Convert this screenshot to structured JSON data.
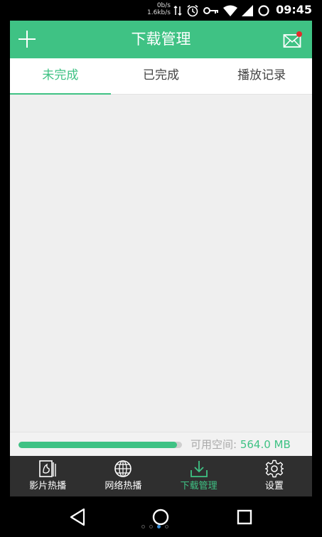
{
  "status_bar": {
    "upload_speed": "0b/s",
    "download_speed": "1.6kb/s",
    "time": "09:45",
    "icons": [
      "data-arrows-icon",
      "alarm-icon",
      "key-icon",
      "wifi-icon",
      "signal-icon",
      "sync-icon"
    ]
  },
  "header": {
    "title": "下载管理",
    "add_icon": "plus-icon",
    "mail_icon": "mail-icon",
    "mail_has_notification": true,
    "color": "#3fc284"
  },
  "tabs": [
    {
      "label": "未完成",
      "active": true
    },
    {
      "label": "已完成",
      "active": false
    },
    {
      "label": "播放记录",
      "active": false
    }
  ],
  "storage": {
    "label": "可用空间:",
    "value": "564.0 MB",
    "used_fraction": 0.97
  },
  "bottom_nav": [
    {
      "label": "影片热播",
      "icon": "movie-icon",
      "active": false
    },
    {
      "label": "网络热播",
      "icon": "globe-icon",
      "active": false
    },
    {
      "label": "下载管理",
      "icon": "download-icon",
      "active": true
    },
    {
      "label": "设置",
      "icon": "gear-icon",
      "active": false
    }
  ],
  "system_nav": {
    "icons": [
      "back-icon",
      "home-icon",
      "recents-icon"
    ],
    "page_indicator": {
      "count": 4,
      "active": 2
    }
  }
}
